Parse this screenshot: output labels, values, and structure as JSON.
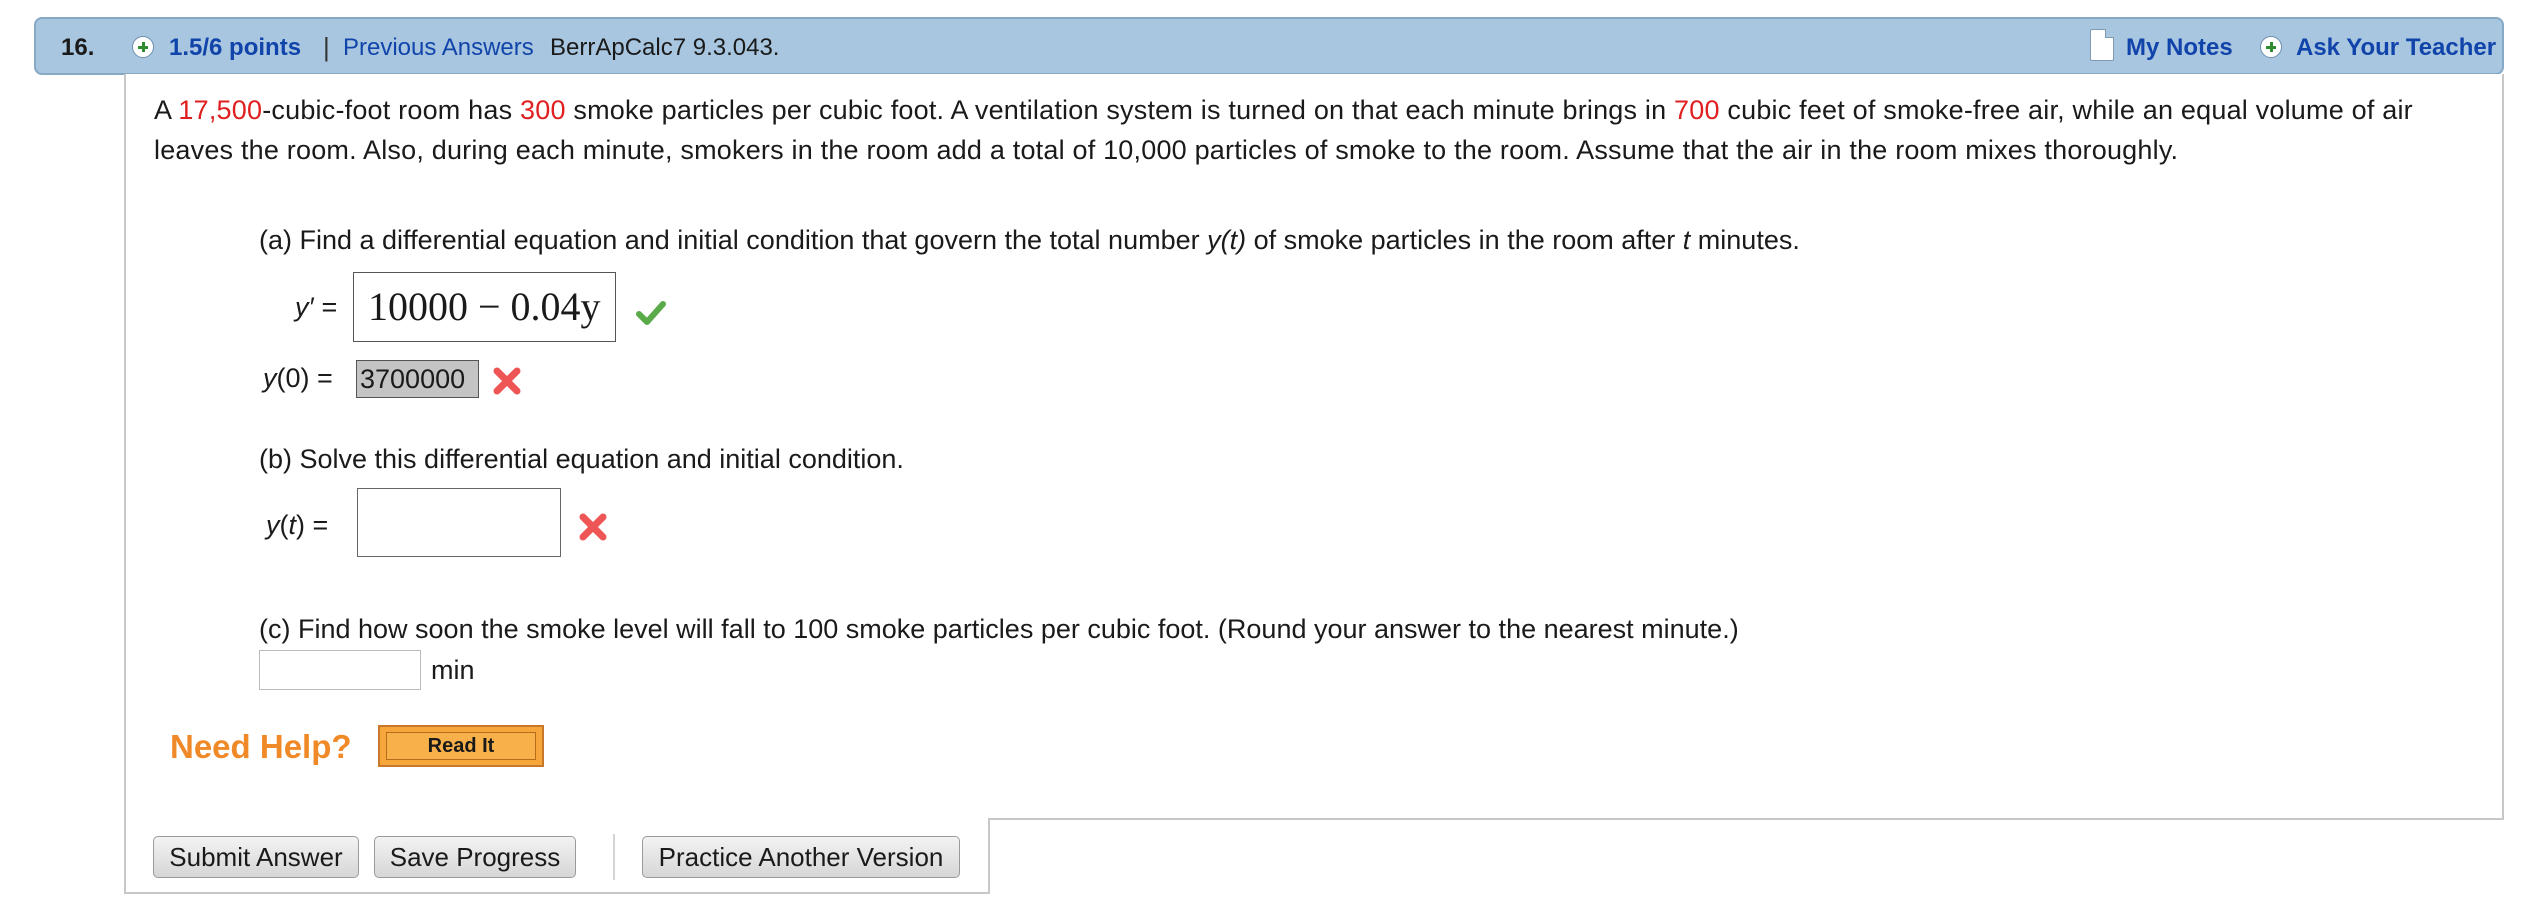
{
  "header": {
    "question_number": "16.",
    "points": "1.5/6 points",
    "separator": "|",
    "previous_answers": "Previous Answers",
    "reference": "BerrApCalc7 9.3.043.",
    "my_notes": "My Notes",
    "ask_teacher": "Ask Your Teacher"
  },
  "problem": {
    "segments": [
      {
        "text": "A ",
        "highlight": false
      },
      {
        "text": "17,500",
        "highlight": true
      },
      {
        "text": "-cubic-foot room has ",
        "highlight": false
      },
      {
        "text": "300",
        "highlight": true
      },
      {
        "text": " smoke particles per cubic foot. A ventilation system is turned on that each minute brings in ",
        "highlight": false
      },
      {
        "text": "700",
        "highlight": true
      },
      {
        "text": " cubic feet of smoke-free air, while an equal volume of air leaves the room. Also, during each minute, smokers in the room add a total of 10,000 particles of smoke to the room. Assume that the air in the room mixes thoroughly.",
        "highlight": false
      }
    ],
    "highlight_color": "#e02020"
  },
  "part_a": {
    "prompt_1": "(a) Find a differential equation and initial condition that govern the total number ",
    "prompt_var": "y(t)",
    "prompt_2": " of smoke particles in the room after ",
    "prompt_t": "t",
    "prompt_3": " minutes.",
    "yprime_label": "y′ =",
    "yprime_answer": "10000 − 0.04y",
    "yprime_status": "correct",
    "y0_label": "y(0) =",
    "y0_answer": "3700000",
    "y0_status": "incorrect"
  },
  "part_b": {
    "prompt": "(b) Solve this differential equation and initial condition.",
    "yt_label": "y(t) =",
    "yt_answer": "",
    "yt_status": "incorrect"
  },
  "part_c": {
    "prompt": "(c) Find how soon the smoke level will fall to 100 smoke particles per cubic foot. (Round your answer to the nearest minute.)",
    "answer": "",
    "unit": "min"
  },
  "help": {
    "need_help": "Need Help?",
    "read_it": "Read It"
  },
  "buttons": {
    "submit": "Submit Answer",
    "save": "Save Progress",
    "practice": "Practice Another Version"
  },
  "icons": {
    "points_expand": "plus-circle-icon",
    "my_notes": "note-icon",
    "ask_teacher": "plus-circle-icon",
    "correct": "checkmark-icon",
    "incorrect": "x-mark-icon"
  },
  "colors": {
    "header_bg": "#a8c6df",
    "link": "#1144aa",
    "correct": "#5aaa4a",
    "incorrect": "#ee5555",
    "need_help": "#f08a28"
  }
}
